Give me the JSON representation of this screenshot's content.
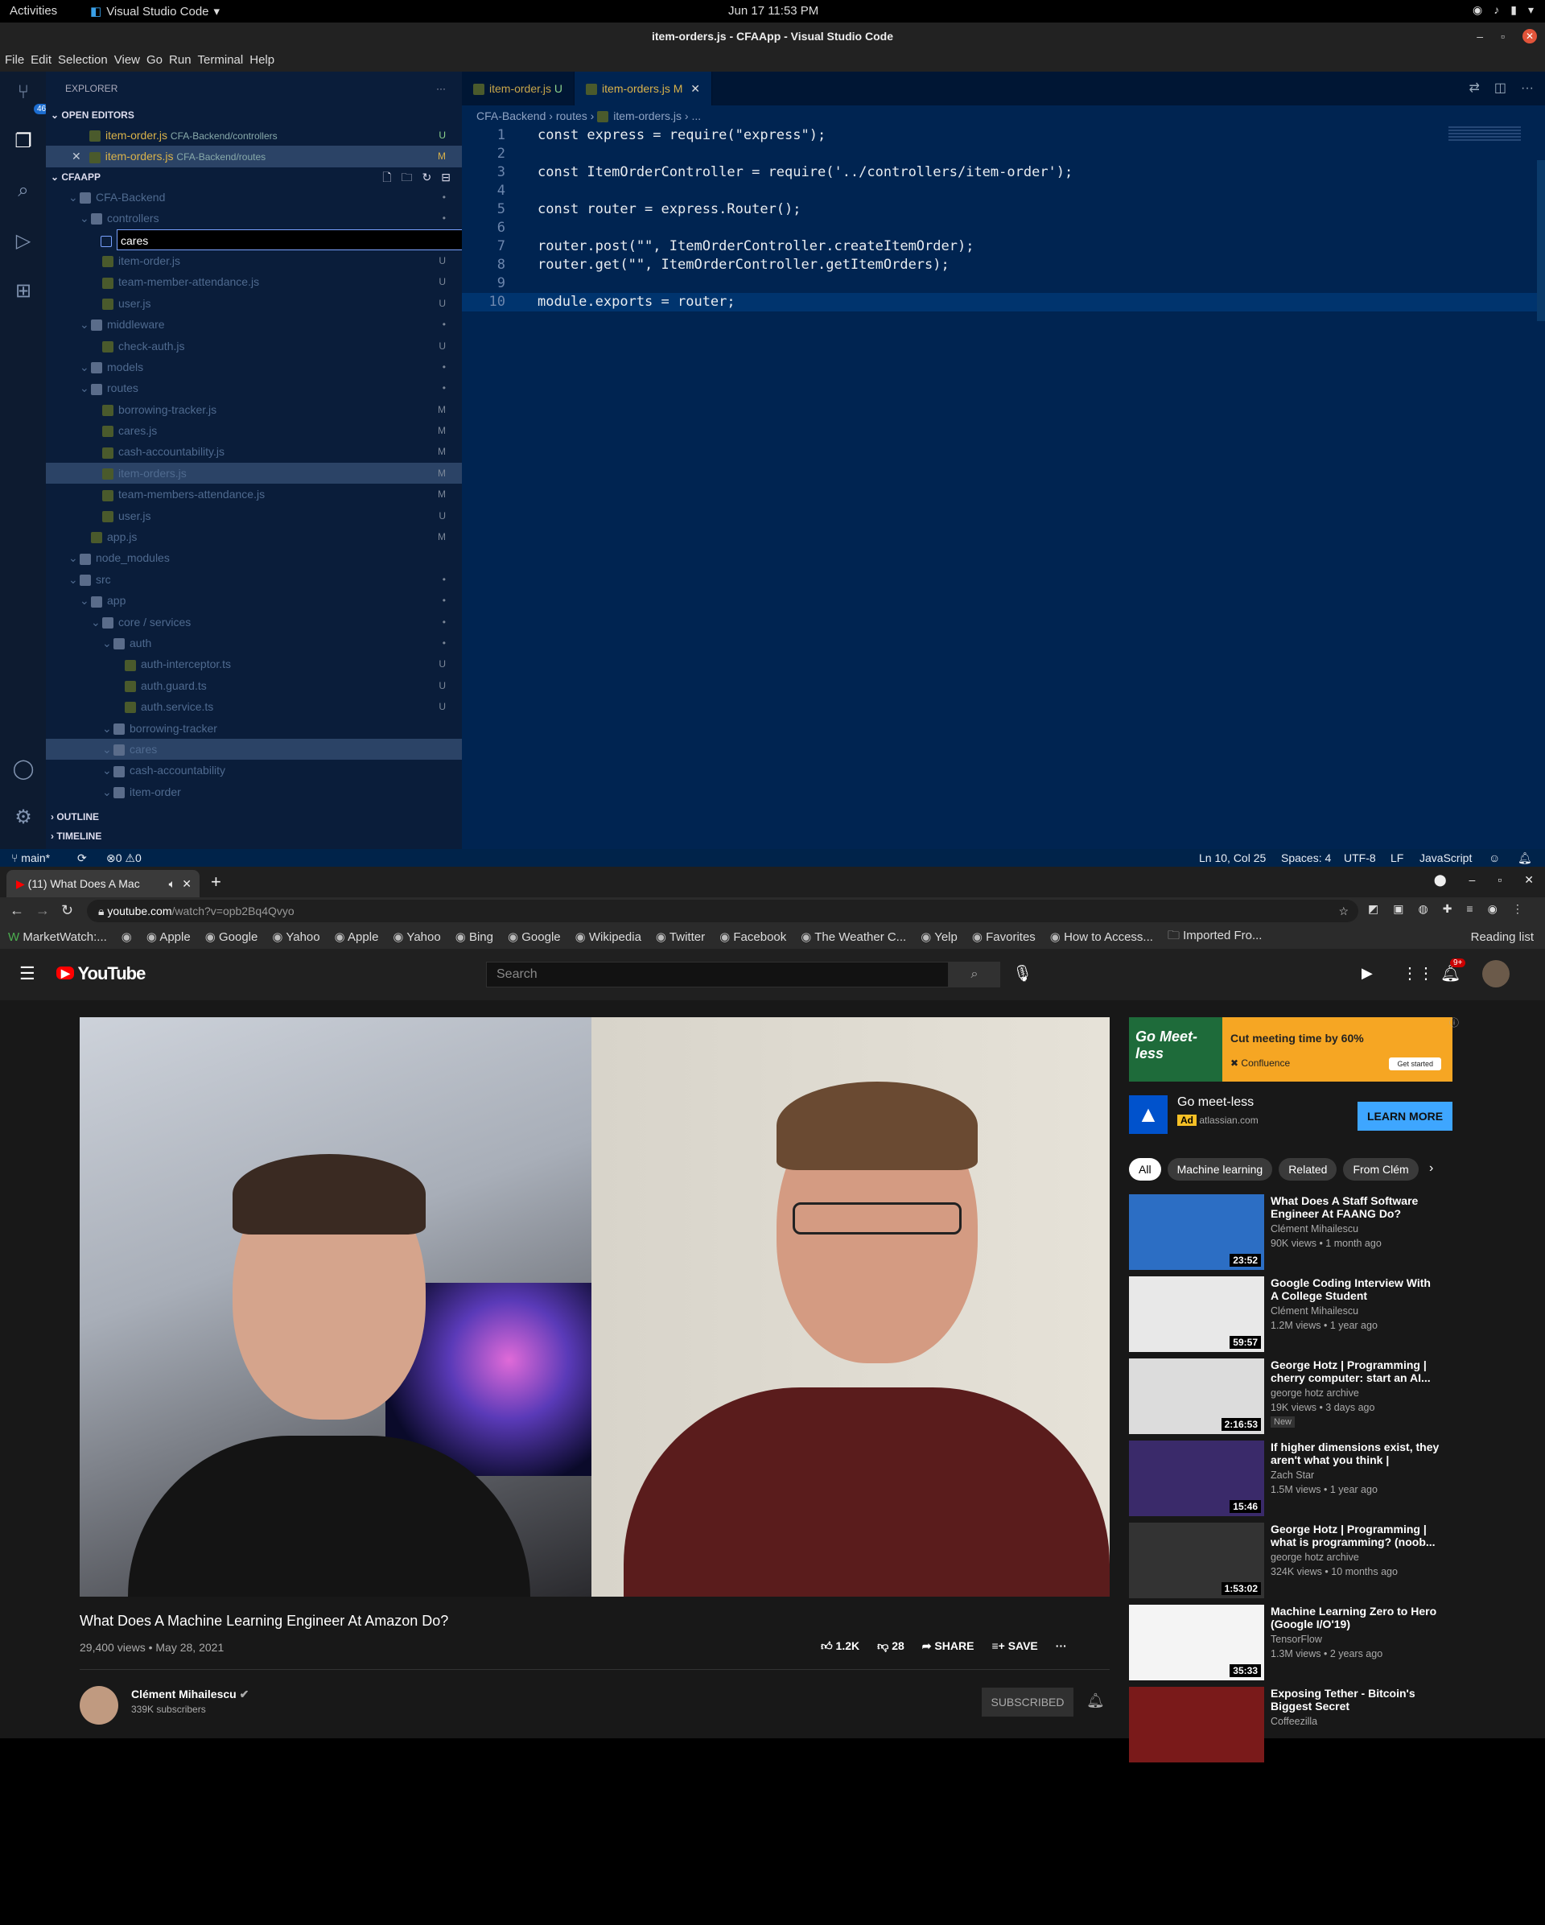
{
  "gnome": {
    "activities": "Activities",
    "app": "Visual Studio Code",
    "clock": "Jun 17  11:53 PM"
  },
  "vscode": {
    "title": "item-orders.js - CFAApp - Visual Studio Code",
    "menu": [
      "File",
      "Edit",
      "Selection",
      "View",
      "Go",
      "Run",
      "Terminal",
      "Help"
    ],
    "badge": "46",
    "explorer_title": "EXPLORER",
    "open_editors_label": "OPEN EDITORS",
    "open_editors": [
      {
        "name": "item-order.js",
        "path": "CFA-Backend/controllers",
        "status": "U"
      },
      {
        "name": "item-orders.js",
        "path": "CFA-Backend/routes",
        "status": "M"
      }
    ],
    "project": "CFAAPP",
    "tree": [
      {
        "name": "CFA-Backend",
        "status": "•",
        "indent": 1,
        "folder": true
      },
      {
        "name": "controllers",
        "status": "•",
        "indent": 2,
        "folder": true
      },
      {
        "name": "item-order.js",
        "status": "U",
        "indent": 3
      },
      {
        "name": "team-member-attendance.js",
        "status": "U",
        "indent": 3
      },
      {
        "name": "user.js",
        "status": "U",
        "indent": 3
      },
      {
        "name": "middleware",
        "status": "•",
        "indent": 2,
        "folder": true
      },
      {
        "name": "check-auth.js",
        "status": "U",
        "indent": 3
      },
      {
        "name": "models",
        "status": "•",
        "indent": 2,
        "folder": true
      },
      {
        "name": "routes",
        "status": "•",
        "indent": 2,
        "folder": true
      },
      {
        "name": "borrowing-tracker.js",
        "status": "M",
        "indent": 3
      },
      {
        "name": "cares.js",
        "status": "M",
        "indent": 3
      },
      {
        "name": "cash-accountability.js",
        "status": "M",
        "indent": 3
      },
      {
        "name": "item-orders.js",
        "status": "M",
        "indent": 3,
        "selected": true
      },
      {
        "name": "team-members-attendance.js",
        "status": "M",
        "indent": 3
      },
      {
        "name": "user.js",
        "status": "U",
        "indent": 3
      },
      {
        "name": "app.js",
        "status": "M",
        "indent": 2
      },
      {
        "name": "node_modules",
        "status": "",
        "indent": 1,
        "folder": true
      },
      {
        "name": "src",
        "status": "•",
        "indent": 1,
        "folder": true
      },
      {
        "name": "app",
        "status": "•",
        "indent": 2,
        "folder": true
      },
      {
        "name": "core / services",
        "status": "•",
        "indent": 3,
        "folder": true
      },
      {
        "name": "auth",
        "status": "•",
        "indent": 4,
        "folder": true
      },
      {
        "name": "auth-interceptor.ts",
        "status": "U",
        "indent": 5
      },
      {
        "name": "auth.guard.ts",
        "status": "U",
        "indent": 5
      },
      {
        "name": "auth.service.ts",
        "status": "U",
        "indent": 5
      },
      {
        "name": "borrowing-tracker",
        "status": "",
        "indent": 4,
        "folder": true
      },
      {
        "name": "cares",
        "status": "",
        "indent": 4,
        "folder": true,
        "selected": true
      },
      {
        "name": "cash-accountability",
        "status": "",
        "indent": 4,
        "folder": true
      },
      {
        "name": "item-order",
        "status": "",
        "indent": 4,
        "folder": true
      }
    ],
    "new_file_input": "cares",
    "outline_label": "OUTLINE",
    "timeline_label": "TIMELINE",
    "tabs": [
      {
        "name": "item-order.js",
        "status": "U"
      },
      {
        "name": "item-orders.js",
        "status": "M"
      }
    ],
    "breadcrumbs": [
      "CFA-Backend",
      "routes",
      "item-orders.js",
      "..."
    ],
    "code": [
      "const express = require(\"express\");",
      "",
      "const ItemOrderController = require('../controllers/item-order');",
      "",
      "const router = express.Router();",
      "",
      "router.post(\"\", ItemOrderController.createItemOrder);",
      "router.get(\"\", ItemOrderController.getItemOrders);",
      "",
      "module.exports = router;"
    ],
    "status": {
      "branch": "main*",
      "errors": "0",
      "warnings": "0",
      "position": "Ln 10, Col 25",
      "spaces": "Spaces: 4",
      "encoding": "UTF-8",
      "eol": "LF",
      "language": "JavaScript"
    }
  },
  "chrome": {
    "tab_title": "(11) What Does A Mac",
    "url_host": "youtube.com",
    "url_path": "/watch?v=opb2Bq4Qvyo",
    "bookmarks": [
      "MarketWatch:...",
      "",
      "Apple",
      "Google",
      "Yahoo",
      "Apple",
      "Yahoo",
      "Bing",
      "Google",
      "Wikipedia",
      "Twitter",
      "Facebook",
      "The Weather C...",
      "Yelp",
      "Favorites",
      "How to Access...",
      "Imported Fro..."
    ],
    "reading_list": "Reading list"
  },
  "youtube": {
    "logo": "YouTube",
    "search_placeholder": "Search",
    "notif_count": "9+",
    "video_title": "What Does A Machine Learning Engineer At Amazon Do?",
    "video_meta": "29,400 views • May 28, 2021",
    "likes": "1.2K",
    "dislikes": "28",
    "share": "SHARE",
    "save": "SAVE",
    "channel": "Clément Mihailescu",
    "subs": "339K subscribers",
    "subscribed": "SUBSCRIBED",
    "ad": {
      "banner_left": "Go Meet-less",
      "banner_headline": "Cut meeting time by 60%",
      "banner_brand": "Confluence",
      "banner_cta": "Get started",
      "title": "Go meet-less",
      "label": "Ad",
      "domain": "atlassian.com",
      "button": "LEARN MORE"
    },
    "chips": [
      "All",
      "Machine learning",
      "Related",
      "From Clém"
    ],
    "recs": [
      {
        "title": "What Does A Staff Software Engineer At FAANG Do?",
        "channel": "Clément Mihailescu",
        "meta": "90K views • 1 month ago",
        "duration": "23:52",
        "thumb": "#2c6ec4"
      },
      {
        "title": "Google Coding Interview With A College Student",
        "channel": "Clément Mihailescu",
        "meta": "1.2M views • 1 year ago",
        "duration": "59:57",
        "thumb": "#e8e8e8"
      },
      {
        "title": "George Hotz | Programming | cherry computer: start an AI...",
        "channel": "george hotz archive",
        "meta": "19K views • 3 days ago",
        "badge": "New",
        "duration": "2:16:53",
        "thumb": "#dcdcdc"
      },
      {
        "title": "If higher dimensions exist, they aren't what you think | Explorin...",
        "channel": "Zach Star",
        "meta": "1.5M views • 1 year ago",
        "duration": "15:46",
        "thumb": "#3a2a6a"
      },
      {
        "title": "George Hotz | Programming | what is programming? (noob...",
        "channel": "george hotz archive",
        "meta": "324K views • 10 months ago",
        "duration": "1:53:02",
        "thumb": "#333"
      },
      {
        "title": "Machine Learning Zero to Hero (Google I/O'19)",
        "channel": "TensorFlow",
        "meta": "1.3M views • 2 years ago",
        "duration": "35:33",
        "thumb": "#f4f4f4"
      },
      {
        "title": "Exposing Tether - Bitcoin's Biggest Secret",
        "channel": "Coffeezilla",
        "meta": "",
        "duration": "",
        "thumb": "#7a1a1a"
      }
    ]
  }
}
